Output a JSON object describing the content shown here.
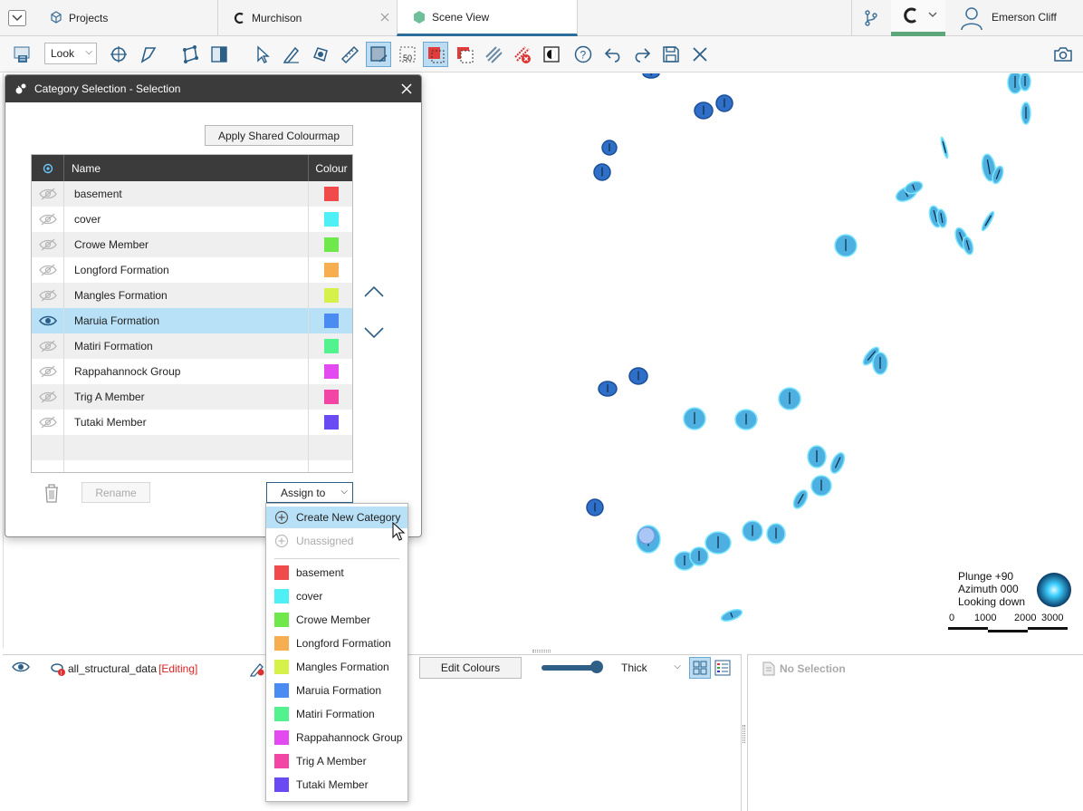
{
  "tabs": {
    "projects": "Projects",
    "murchison": "Murchison",
    "scene_view": "Scene View"
  },
  "user": {
    "name": "Emerson Cliff"
  },
  "toolbar": {
    "look": "Look"
  },
  "dialog": {
    "title": "Category Selection - Selection",
    "apply_shared": "Apply Shared Colourmap",
    "col_name": "Name",
    "col_colour": "Colour",
    "rename": "Rename",
    "assign_to": "Assign to",
    "categories": [
      {
        "name": "basement",
        "color": "#f04a4a",
        "visible": false
      },
      {
        "name": "cover",
        "color": "#4ef0f6",
        "visible": false
      },
      {
        "name": "Crowe Member",
        "color": "#6ee84a",
        "visible": false
      },
      {
        "name": "Longford Formation",
        "color": "#f7ae50",
        "visible": false
      },
      {
        "name": "Mangles Formation",
        "color": "#d6f24a",
        "visible": false
      },
      {
        "name": "Maruia Formation",
        "color": "#4a8cf2",
        "visible": true,
        "selected": true
      },
      {
        "name": "Matiri Formation",
        "color": "#52f28e",
        "visible": false
      },
      {
        "name": "Rappahannock Group",
        "color": "#e34af0",
        "visible": false
      },
      {
        "name": "Trig A Member",
        "color": "#f245a6",
        "visible": false
      },
      {
        "name": "Tutaki Member",
        "color": "#6a4af2",
        "visible": false
      }
    ]
  },
  "menu": {
    "create_new": "Create New Category",
    "unassigned": "Unassigned",
    "items": [
      {
        "name": "basement",
        "color": "#f04a4a"
      },
      {
        "name": "cover",
        "color": "#4ef0f6"
      },
      {
        "name": "Crowe Member",
        "color": "#6ee84a"
      },
      {
        "name": "Longford Formation",
        "color": "#f7ae50"
      },
      {
        "name": "Mangles Formation",
        "color": "#d6f24a"
      },
      {
        "name": "Maruia Formation",
        "color": "#4a8cf2"
      },
      {
        "name": "Matiri Formation",
        "color": "#52f28e"
      },
      {
        "name": "Rappahannock Group",
        "color": "#e34af0"
      },
      {
        "name": "Trig A Member",
        "color": "#f245a6"
      },
      {
        "name": "Tutaki Member",
        "color": "#6a4af2"
      }
    ]
  },
  "scene": {
    "plunge": "Plunge +90",
    "azimuth": "Azimuth 000",
    "looking": "Looking down",
    "scale": [
      "0",
      "1000",
      "2000",
      "3000"
    ]
  },
  "bottom": {
    "layer_name": "all_structural_data",
    "editing": "[Editing]",
    "edit_colours": "Edit Colours",
    "thickness": "Thick",
    "no_selection": "No Selection"
  }
}
